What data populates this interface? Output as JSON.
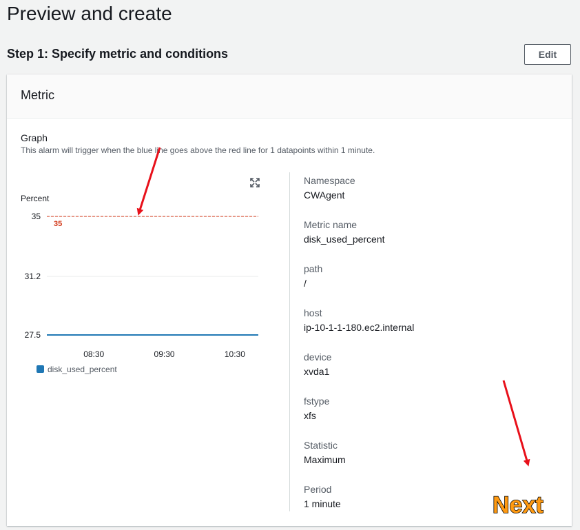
{
  "page": {
    "title": "Preview and create"
  },
  "step": {
    "title": "Step 1: Specify metric and conditions",
    "edit_label": "Edit"
  },
  "panel": {
    "title": "Metric",
    "graph_label": "Graph",
    "graph_description": "This alarm will trigger when the blue line goes above the red line for 1 datapoints within 1 minute."
  },
  "details": [
    {
      "key": "Namespace",
      "value": "CWAgent"
    },
    {
      "key": "Metric name",
      "value": "disk_used_percent"
    },
    {
      "key": "path",
      "value": "/"
    },
    {
      "key": "host",
      "value": "ip-10-1-1-180.ec2.internal"
    },
    {
      "key": "device",
      "value": "xvda1"
    },
    {
      "key": "fstype",
      "value": "xfs"
    },
    {
      "key": "Statistic",
      "value": "Maximum"
    },
    {
      "key": "Period",
      "value": "1 minute"
    }
  ],
  "annotation": {
    "next_label": "Next"
  },
  "icons": {
    "expand": "expand-icon"
  },
  "chart_data": {
    "type": "line",
    "ylabel": "Percent",
    "y_ticks": [
      "35",
      "31.2",
      "27.5"
    ],
    "ylim": [
      27.5,
      35
    ],
    "x_ticks": [
      "08:30",
      "09:30",
      "10:30"
    ],
    "threshold": {
      "value": 35,
      "label": "35",
      "color": "#d13212"
    },
    "series": [
      {
        "name": "disk_used_percent",
        "color": "#1f77b4",
        "x": [
          "07:50",
          "10:50"
        ],
        "values": [
          27.5,
          27.5
        ]
      }
    ],
    "legend": "bottom-left",
    "grid": true
  }
}
